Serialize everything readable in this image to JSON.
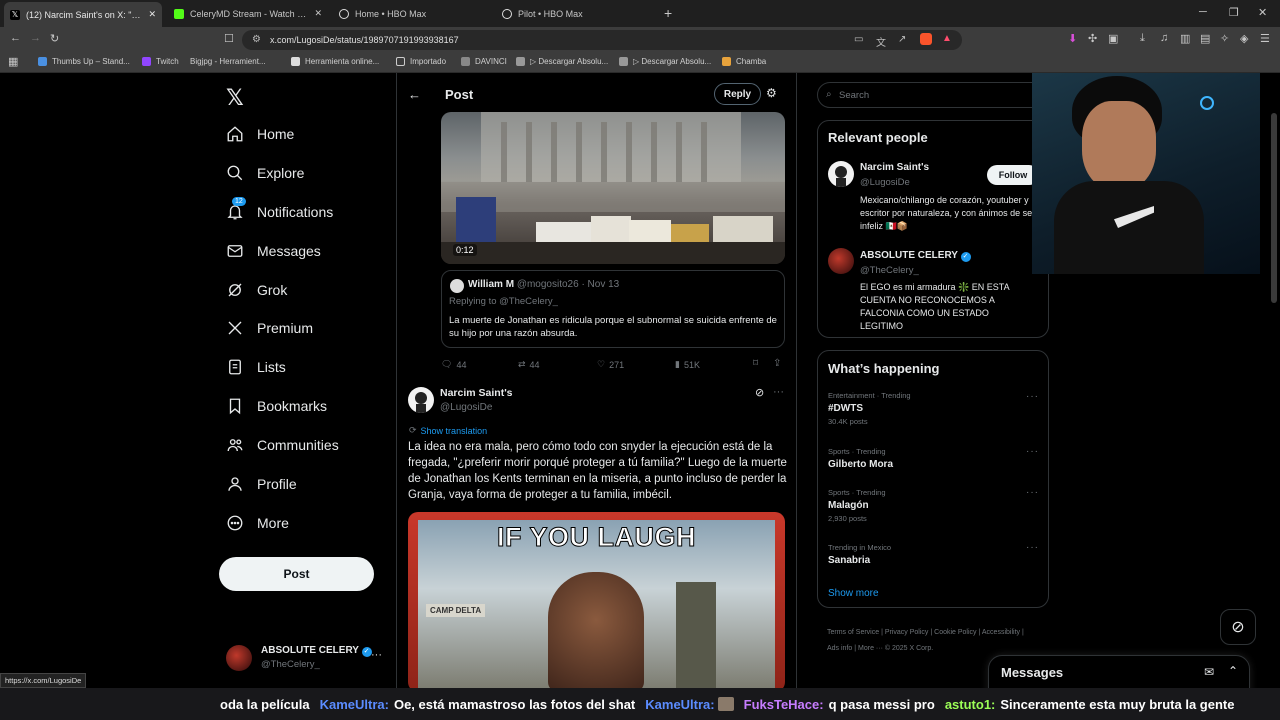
{
  "browser": {
    "tabs": [
      {
        "title": "(12) Narcim Saint's on X: \"@The",
        "active": true,
        "color": "#ffffff"
      },
      {
        "title": "CeleryMD Stream - Watch Live on Ki",
        "active": false,
        "color": "#53fc18"
      },
      {
        "title": "Home • HBO Max",
        "active": false,
        "color": "#ffffff"
      },
      {
        "title": "Pilot • HBO Max",
        "active": false,
        "color": "#ffffff"
      }
    ],
    "url": "x.com/LugosiDe/status/1989707191993938167",
    "bookmarks": [
      {
        "label": "Thumbs Up – Stand...",
        "color": "#4a90e2"
      },
      {
        "label": "Twitch",
        "color": "#9146ff"
      },
      {
        "label": "Bigjpg - Herramient...",
        "color": "#222222"
      },
      {
        "label": "Herramienta online...",
        "color": "#dddddd"
      },
      {
        "label": "Importado",
        "color": "#aaaaaa"
      },
      {
        "label": "DAVINCI",
        "color": "#888888"
      },
      {
        "label": "▷ Descargar Absolu...",
        "color": "#999999"
      },
      {
        "label": "▷ Descargar Absolu...",
        "color": "#999999"
      },
      {
        "label": "Chamba",
        "color": "#e8a33c"
      }
    ],
    "status_url": "https://x.com/LugosiDe"
  },
  "sidebar": {
    "items": [
      {
        "label": "Home",
        "icon": "home-icon"
      },
      {
        "label": "Explore",
        "icon": "search-icon"
      },
      {
        "label": "Notifications",
        "icon": "bell-icon",
        "badge": "12"
      },
      {
        "label": "Messages",
        "icon": "envelope-icon"
      },
      {
        "label": "Grok",
        "icon": "grok-icon"
      },
      {
        "label": "Premium",
        "icon": "x-icon"
      },
      {
        "label": "Lists",
        "icon": "list-icon"
      },
      {
        "label": "Bookmarks",
        "icon": "bookmark-icon"
      },
      {
        "label": "Communities",
        "icon": "people-icon"
      },
      {
        "label": "Profile",
        "icon": "person-icon"
      },
      {
        "label": "More",
        "icon": "more-circle-icon"
      }
    ],
    "post_button": "Post",
    "account": {
      "name": "ABSOLUTE CELERY",
      "handle": "@TheCelery_"
    }
  },
  "header": {
    "title": "Post",
    "reply_button": "Reply"
  },
  "video": {
    "duration": "0:12"
  },
  "quoted": {
    "name": "William M",
    "handle": "@mogosito26",
    "date": "· Nov 13",
    "replying": "Replying to @TheCelery_",
    "text": "La muerte de Jonathan es ridicula porque el subnormal se suicida enfrente de su hijo por una razón absurda."
  },
  "stats": {
    "replies": "44",
    "reposts": "44",
    "likes": "271",
    "views": "51K"
  },
  "tweet": {
    "name": "Narcim Saint's",
    "handle": "@LugosiDe",
    "show_translation": "Show translation",
    "text": "La idea no era mala, pero cómo todo con snyder la ejecución está de la fregada, \"¿preferir morir porqué proteger a tú familia?\" Luego de la muerte de Jonathan los Kents terminan en la miseria, a punto incluso de perder la Granja, vaya forma de proteger a tu familia, imbécil.",
    "image_caption": "IF YOU LAUGH",
    "image_sign": "CAMP DELTA"
  },
  "search": {
    "placeholder": "Search"
  },
  "relevant": {
    "title": "Relevant people",
    "people": [
      {
        "name": "Narcim Saint's",
        "handle": "@LugosiDe",
        "bio": "Mexicano/chilango de corazón, youtuber y escritor por naturaleza, y con ánimos de ser infeliz 🇲🇽📦",
        "follow": "Follow",
        "verified": false
      },
      {
        "name": "ABSOLUTE CELERY",
        "handle": "@TheCelery_",
        "bio": "El EGO es mi armadura ❇️ EN ESTA CUENTA NO RECONOCEMOS A FALCONIA COMO UN ESTADO LEGITIMO",
        "verified": true
      }
    ]
  },
  "happening": {
    "title": "What’s happening",
    "trends": [
      {
        "meta": "Entertainment · Trending",
        "topic": "#DWTS",
        "count": "30.4K posts"
      },
      {
        "meta": "Sports · Trending",
        "topic": "Gilberto Mora",
        "count": ""
      },
      {
        "meta": "Sports · Trending",
        "topic": "Malagón",
        "count": "2,930 posts"
      },
      {
        "meta": "Trending in Mexico",
        "topic": "Sanabria",
        "count": ""
      }
    ],
    "show_more": "Show more"
  },
  "footer": {
    "links": [
      "Terms of Service",
      "Privacy Policy",
      "Cookie Policy",
      "Accessibility",
      "Ads info",
      "More ···",
      "© 2025 X Corp."
    ]
  },
  "messages": {
    "title": "Messages"
  },
  "chat": {
    "messages": [
      {
        "user": "",
        "text": "oda la película",
        "color": "#ffffff"
      },
      {
        "user": "KameUltra:",
        "text": "Oe, está mamastroso las fotos del shat",
        "color": "#5b8cff"
      },
      {
        "user": "KameUltra:",
        "text": "",
        "color": "#5b8cff"
      },
      {
        "user": "FuksTeHace:",
        "text": "q pasa messi pro",
        "color": "#c77dff"
      },
      {
        "user": "astuto1:",
        "text": "Sinceramente esta muy bruta la gente",
        "color": "#9cff57"
      }
    ]
  },
  "colors": {
    "accent": "#1d9bf0",
    "background": "#000000",
    "border": "#2f3336"
  }
}
